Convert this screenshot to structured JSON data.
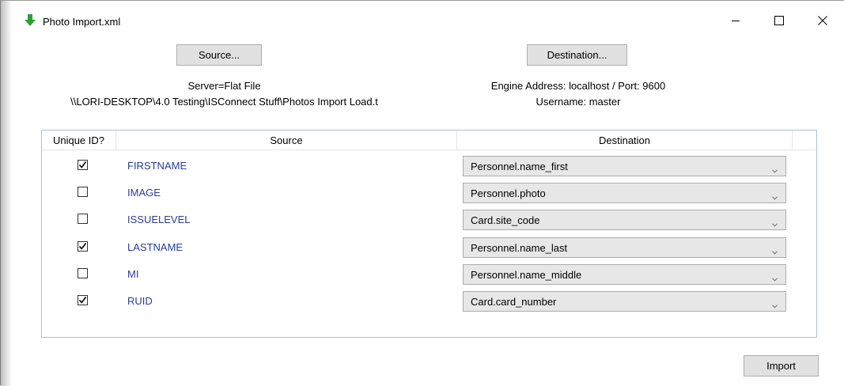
{
  "window": {
    "title": "Photo Import.xml",
    "icon": "green-down-arrow-icon"
  },
  "toolbar": {
    "source_label": "Source...",
    "destination_label": "Destination..."
  },
  "source_info": {
    "server": "Server=Flat File",
    "path": "\\\\LORI-DESKTOP\\4.0 Testing\\ISConnect Stuff\\Photos Import Load.t"
  },
  "destination_info": {
    "engine": "Engine Address: localhost / Port: 9600",
    "username": "Username: master"
  },
  "grid": {
    "columns": [
      "Unique ID?",
      "Source",
      "Destination"
    ],
    "rows": [
      {
        "unique": true,
        "source": "FIRSTNAME",
        "destination": "Personnel.name_first"
      },
      {
        "unique": false,
        "source": "IMAGE",
        "destination": "Personnel.photo"
      },
      {
        "unique": false,
        "source": "ISSUELEVEL",
        "destination": "Card.site_code"
      },
      {
        "unique": true,
        "source": "LASTNAME",
        "destination": "Personnel.name_last"
      },
      {
        "unique": false,
        "source": "MI",
        "destination": "Personnel.name_middle"
      },
      {
        "unique": true,
        "source": "RUID",
        "destination": "Card.card_number"
      }
    ]
  },
  "footer": {
    "import_label": "Import"
  },
  "colors": {
    "source_text": "#2d3c96",
    "grid_border": "#a7c3d8",
    "icon_green": "#2e9e3a"
  }
}
